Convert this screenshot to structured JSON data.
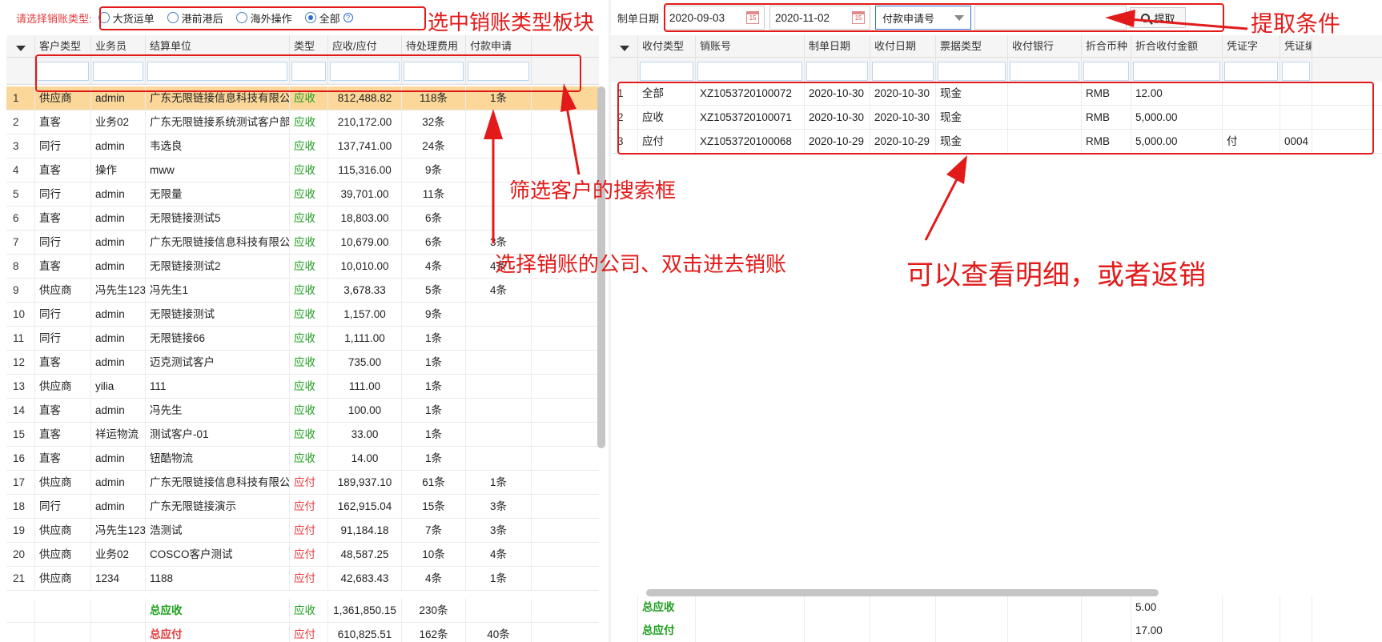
{
  "left": {
    "type_label": "请选择销账类型:",
    "radio_options": [
      {
        "label": "大货运单",
        "checked": false
      },
      {
        "label": "港前港后",
        "checked": false
      },
      {
        "label": "海外操作",
        "checked": false
      },
      {
        "label": "全部",
        "checked": true
      }
    ],
    "columns": [
      "客户类型",
      "业务员",
      "结算单位",
      "类型",
      "应收/应付",
      "待处理费用",
      "付款申请"
    ],
    "rows": [
      {
        "n": "1",
        "ctype": "供应商",
        "staff": "admin",
        "unit": "广东无限链接信息科技有限公司",
        "kind": "应收",
        "amount": "812,488.82",
        "pending": "118条",
        "apply": "1条"
      },
      {
        "n": "2",
        "ctype": "直客",
        "staff": "业务02",
        "unit": "广东无限链接系统测试客户部",
        "kind": "应收",
        "amount": "210,172.00",
        "pending": "32条",
        "apply": ""
      },
      {
        "n": "3",
        "ctype": "同行",
        "staff": "admin",
        "unit": "韦选良",
        "kind": "应收",
        "amount": "137,741.00",
        "pending": "24条",
        "apply": ""
      },
      {
        "n": "4",
        "ctype": "直客",
        "staff": "操作",
        "unit": "mww",
        "kind": "应收",
        "amount": "115,316.00",
        "pending": "9条",
        "apply": ""
      },
      {
        "n": "5",
        "ctype": "同行",
        "staff": "admin",
        "unit": "无限量",
        "kind": "应收",
        "amount": "39,701.00",
        "pending": "11条",
        "apply": ""
      },
      {
        "n": "6",
        "ctype": "直客",
        "staff": "admin",
        "unit": "无限链接测试5",
        "kind": "应收",
        "amount": "18,803.00",
        "pending": "6条",
        "apply": ""
      },
      {
        "n": "7",
        "ctype": "同行",
        "staff": "admin",
        "unit": "广东无限链接信息科技有限公司",
        "kind": "应收",
        "amount": "10,679.00",
        "pending": "6条",
        "apply": "3条"
      },
      {
        "n": "8",
        "ctype": "直客",
        "staff": "admin",
        "unit": "无限链接测试2",
        "kind": "应收",
        "amount": "10,010.00",
        "pending": "4条",
        "apply": "4条"
      },
      {
        "n": "9",
        "ctype": "供应商",
        "staff": "冯先生123",
        "unit": "冯先生1",
        "kind": "应收",
        "amount": "3,678.33",
        "pending": "5条",
        "apply": "4条"
      },
      {
        "n": "10",
        "ctype": "同行",
        "staff": "admin",
        "unit": "无限链接测试",
        "kind": "应收",
        "amount": "1,157.00",
        "pending": "9条",
        "apply": ""
      },
      {
        "n": "11",
        "ctype": "同行",
        "staff": "admin",
        "unit": "无限链接66",
        "kind": "应收",
        "amount": "1,111.00",
        "pending": "1条",
        "apply": ""
      },
      {
        "n": "12",
        "ctype": "直客",
        "staff": "admin",
        "unit": "迈克测试客户",
        "kind": "应收",
        "amount": "735.00",
        "pending": "1条",
        "apply": ""
      },
      {
        "n": "13",
        "ctype": "供应商",
        "staff": "yilia",
        "unit": "111",
        "kind": "应收",
        "amount": "111.00",
        "pending": "1条",
        "apply": ""
      },
      {
        "n": "14",
        "ctype": "直客",
        "staff": "admin",
        "unit": "冯先生",
        "kind": "应收",
        "amount": "100.00",
        "pending": "1条",
        "apply": ""
      },
      {
        "n": "15",
        "ctype": "直客",
        "staff": "祥运物流",
        "unit": "测试客户-01",
        "kind": "应收",
        "amount": "33.00",
        "pending": "1条",
        "apply": ""
      },
      {
        "n": "16",
        "ctype": "直客",
        "staff": "admin",
        "unit": "钮酷物流",
        "kind": "应收",
        "amount": "14.00",
        "pending": "1条",
        "apply": ""
      },
      {
        "n": "17",
        "ctype": "供应商",
        "staff": "admin",
        "unit": "广东无限链接信息科技有限公司",
        "kind": "应付",
        "amount": "189,937.10",
        "pending": "61条",
        "apply": "1条"
      },
      {
        "n": "18",
        "ctype": "同行",
        "staff": "admin",
        "unit": "广东无限链接演示",
        "kind": "应付",
        "amount": "162,915.04",
        "pending": "15条",
        "apply": "3条"
      },
      {
        "n": "19",
        "ctype": "供应商",
        "staff": "冯先生123",
        "unit": "浩测试",
        "kind": "应付",
        "amount": "91,184.18",
        "pending": "7条",
        "apply": "3条"
      },
      {
        "n": "20",
        "ctype": "供应商",
        "staff": "业务02",
        "unit": "COSCO客户测试",
        "kind": "应付",
        "amount": "48,587.25",
        "pending": "10条",
        "apply": "4条"
      },
      {
        "n": "21",
        "ctype": "供应商",
        "staff": "1234",
        "unit": "1188",
        "kind": "应付",
        "amount": "42,683.43",
        "pending": "4条",
        "apply": "1条"
      }
    ],
    "totals": [
      {
        "label": "总应收",
        "kind": "应收",
        "amount": "1,361,850.15",
        "pending": "230条",
        "apply": ""
      },
      {
        "label": "总应付",
        "kind": "应付",
        "amount": "610,825.51",
        "pending": "162条",
        "apply": "40条"
      }
    ]
  },
  "right": {
    "date_label": "制单日期",
    "date_from": "2020-09-03",
    "date_to": "2020-11-02",
    "field_select": "付款申请号",
    "search_value": "",
    "fetch_label": "提取",
    "columns": [
      "收付类型",
      "销账号",
      "制单日期",
      "收付日期",
      "票据类型",
      "收付银行",
      "折合币种",
      "折合收付金额",
      "凭证字",
      "凭证编"
    ],
    "rows": [
      {
        "n": "1",
        "ptype": "全部",
        "no": "XZ1053720100072",
        "made": "2020-10-30",
        "paid": "2020-10-30",
        "bill": "现金",
        "bank": "",
        "cur": "RMB",
        "amt": "12.00",
        "vword": "",
        "vno": ""
      },
      {
        "n": "2",
        "ptype": "应收",
        "no": "XZ1053720100071",
        "made": "2020-10-30",
        "paid": "2020-10-30",
        "bill": "现金",
        "bank": "",
        "cur": "RMB",
        "amt": "5,000.00",
        "vword": "",
        "vno": ""
      },
      {
        "n": "3",
        "ptype": "应付",
        "no": "XZ1053720100068",
        "made": "2020-10-29",
        "paid": "2020-10-29",
        "bill": "现金",
        "bank": "",
        "cur": "RMB",
        "amt": "5,000.00",
        "vword": "付",
        "vno": "0004"
      }
    ],
    "totals": [
      {
        "label": "总应收",
        "amt": "5.00"
      },
      {
        "label": "总应付",
        "amt": "17.00"
      }
    ]
  },
  "annotations": {
    "type_block": "选中销账类型板块",
    "fetch_condition": "提取条件",
    "filter_box": "筛选客户的搜索框",
    "select_company": "选择销账的公司、双击进去销账",
    "view_detail": "可以查看明细，或者返销"
  },
  "colors": {
    "receivable": "#1a9e1a",
    "payable": "#e4393c",
    "annotation": "#e21a1a",
    "selected_row": "#fbd79a"
  }
}
